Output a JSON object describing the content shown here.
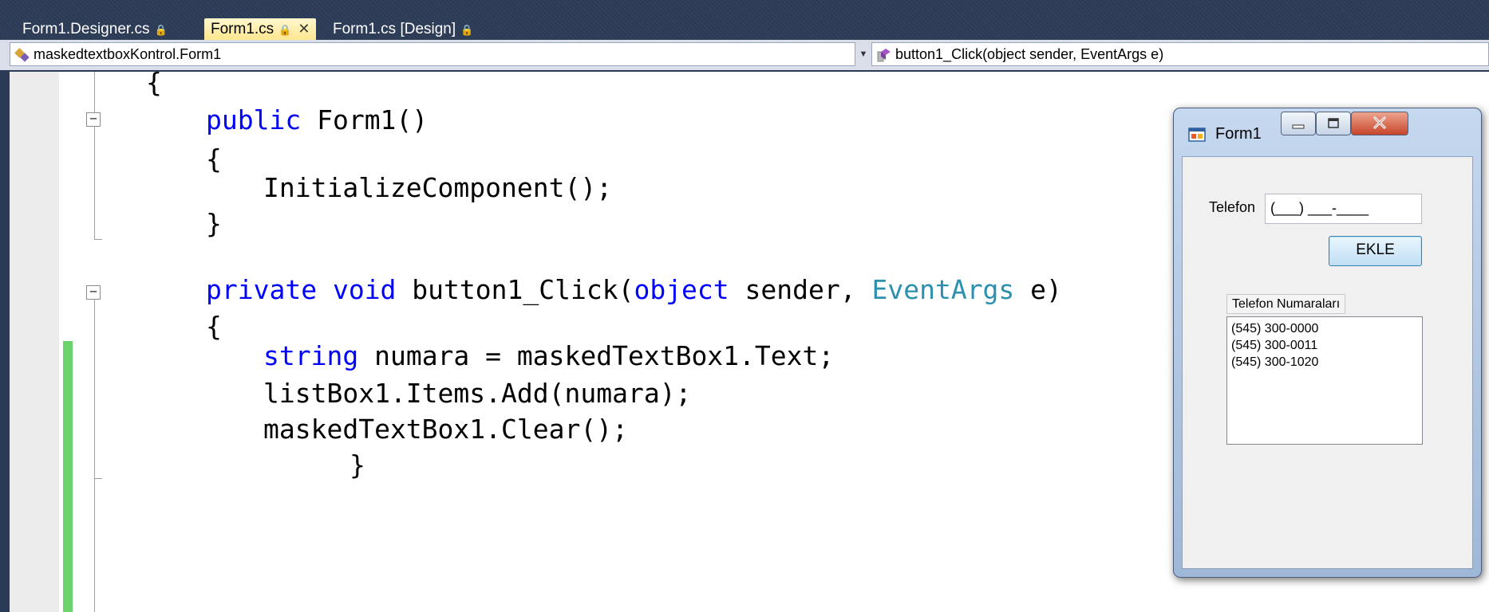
{
  "tabs": [
    {
      "label": "Form1.Designer.cs",
      "active": false
    },
    {
      "label": "Form1.cs",
      "active": true
    },
    {
      "label": "Form1.cs [Design]",
      "active": false
    }
  ],
  "navbar": {
    "type_selector": "maskedtextboxKontrol.Form1",
    "member_selector": "button1_Click(object sender, EventArgs e)"
  },
  "code": {
    "l1": "{",
    "l2_kw": "public",
    "l2_rest": " Form1()",
    "l3": "{",
    "l4": "InitializeComponent();",
    "l5": "}",
    "l6_kw1": "private",
    "l6_kw2": "void",
    "l6_mid": " button1_Click(",
    "l6_kw3": "object",
    "l6_mid2": " sender, ",
    "l6_type": "EventArgs",
    "l6_end": " e)",
    "l7": "{",
    "l8_kw": "string",
    "l8_rest": " numara = maskedTextBox1.Text;",
    "l9": "listBox1.Items.Add(numara);",
    "l10": "maskedTextBox1.Clear();",
    "l11": "}"
  },
  "form1": {
    "title": "Form1",
    "telefon_label": "Telefon",
    "masked_value": "(___) ___-____",
    "ekle_button": "EKLE",
    "list_label": "Telefon Numaraları",
    "list_items": [
      "(545) 300-0000",
      "(545) 300-0011",
      "(545) 300-1020"
    ]
  },
  "icons": [
    "lock-icon",
    "close-icon",
    "class-icon",
    "method-icon",
    "form-icon",
    "minimize-icon",
    "maximize-icon",
    "window-close-icon",
    "collapse-icon"
  ],
  "colors": {
    "keyword": "#0000ff",
    "type": "#2b91af",
    "active_tab": "#ffe68f",
    "chrome": "#2b3a55",
    "change_bar": "#6ad36a"
  }
}
